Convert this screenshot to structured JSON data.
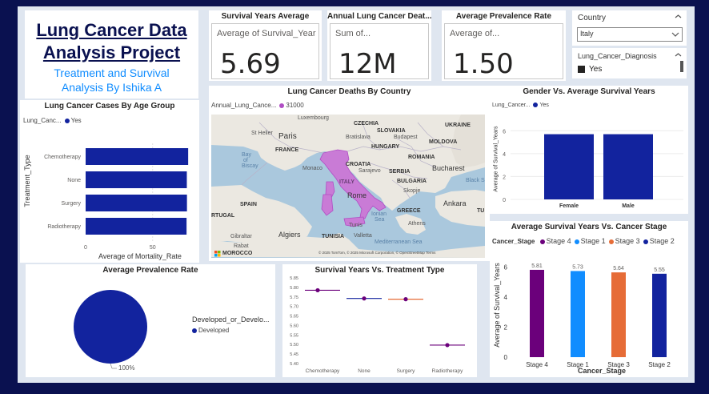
{
  "title": {
    "line1": "Lung Cancer Data",
    "line2": "Analysis Project",
    "sub1": "Treatment and Survival",
    "sub2": "Analysis By Ishika A"
  },
  "cards": [
    {
      "head": "Survival Years Average",
      "label": "Average of Survival_Years",
      "value": "5.69"
    },
    {
      "head": "Annual Lung Cancer Deat...",
      "label": "Sum of...",
      "value": "12M"
    },
    {
      "head": "Average Prevalence Rate",
      "label": "Average of...",
      "value": "1.50"
    }
  ],
  "filters": {
    "country_label": "Country",
    "country_value": "Italy",
    "diagnosis_label": "Lung_Cancer_Diagnosis",
    "diagnosis_value": "Yes"
  },
  "map": {
    "title": "Lung Cancer Deaths By Country",
    "legend_label": "Annual_Lung_Cance...",
    "legend_value": "31000",
    "attribution": "© 2025 TomTom, © 2025 Microsoft Corporation, © OpenStreetMap  Terms",
    "places": [
      "Luxembourg",
      "CZECHIA",
      "UKRAINE",
      "SLOVAKIA",
      "MOLDOVA",
      "St Helier",
      "Paris",
      "Bratislava",
      "Budapest",
      "FRANCE",
      "HUNGARY",
      "ROMANIA",
      "CROATIA",
      "Bay of Biscay",
      "Monaco",
      "Sarajevo",
      "SERBIA",
      "Bucharest",
      "ITALY",
      "BULGARIA",
      "Black Se",
      "Skopje",
      "SPAIN",
      "Rome",
      "GREECE",
      "Ankara",
      "RTUGAL",
      "Ionian Sea",
      "Athens",
      "TU",
      "Tunis",
      "Gibraltar",
      "Algiers",
      "TUNISIA",
      "Rabat",
      "MOROCCO",
      "Valletta",
      "Mediterranean Sea"
    ]
  },
  "age_chart": {
    "title": "Lung Cancer Cases By Age Group",
    "legend_label": "Lung_Canc...",
    "legend_value": "Yes",
    "xlabel": "Average of Mortality_Rate",
    "ylabel": "Treatment_Type"
  },
  "gender_chart": {
    "title": "Gender Vs. Average Survival Years",
    "legend_label": "Lung_Cancer...",
    "legend_value": "Yes",
    "ylabel": "Average of Survival_Years"
  },
  "stage_chart": {
    "title": "Average Survival Years Vs. Cancer Stage",
    "legend_label": "Cancer_Stage",
    "xlabel": "Cancer_Stage",
    "ylabel": "Average of Survival_Years"
  },
  "prevalence_chart": {
    "title": "Average Prevalence Rate",
    "legend_label": "Developed_or_Develo...",
    "legend_value": "Developed",
    "slice_label": "100%"
  },
  "treatment_chart": {
    "title": "Survival Years Vs. Treatment Type"
  },
  "chart_data": [
    {
      "type": "bar",
      "orientation": "horizontal",
      "title": "Lung Cancer Cases By Age Group",
      "categories": [
        "Chemotherapy",
        "None",
        "Surgery",
        "Radiotherapy"
      ],
      "values": [
        76.5,
        75.5,
        75.6,
        75.3
      ],
      "xlabel": "Average of Mortality_Rate",
      "ylabel": "Treatment_Type",
      "xticks": [
        "0",
        "50"
      ],
      "xlim": [
        0,
        80
      ],
      "series": [
        {
          "name": "Yes",
          "color": "#12239e"
        }
      ]
    },
    {
      "type": "bar",
      "title": "Gender Vs. Average Survival Years",
      "categories": [
        "Female",
        "Male"
      ],
      "values": [
        5.7,
        5.7
      ],
      "ylabel": "Average of Survival_Years",
      "yticks": [
        "0",
        "2",
        "4",
        "6"
      ],
      "ylim": [
        0,
        7
      ],
      "series": [
        {
          "name": "Yes",
          "color": "#12239e"
        }
      ]
    },
    {
      "type": "bar",
      "title": "Average Survival Years Vs. Cancer Stage",
      "categories": [
        "Stage 4",
        "Stage 1",
        "Stage 3",
        "Stage 2"
      ],
      "values": [
        5.81,
        5.73,
        5.64,
        5.55
      ],
      "labels": [
        "5.81",
        "5.73",
        "5.64",
        "5.55"
      ],
      "colors": [
        "#6b007b",
        "#118dff",
        "#e66c37",
        "#12239e"
      ],
      "xlabel": "Cancer_Stage",
      "ylabel": "Average of Survival_Years",
      "yticks": [
        "0",
        "2",
        "4",
        "6"
      ],
      "ylim": [
        0,
        6.5
      ],
      "legend": [
        "Stage 4",
        "Stage 1",
        "Stage 3",
        "Stage 2"
      ]
    },
    {
      "type": "pie",
      "title": "Average Prevalence Rate",
      "slices": [
        {
          "name": "Developed",
          "value": 100,
          "color": "#12239e"
        }
      ],
      "slice_label": "100%"
    },
    {
      "type": "scatter",
      "title": "Survival Years Vs. Treatment Type",
      "categories": [
        "Chemotherapy",
        "None",
        "Surgery",
        "Radiotherapy"
      ],
      "values": [
        5.785,
        5.742,
        5.738,
        5.497
      ],
      "line_colors": [
        "#6b007b",
        "#12239e",
        "#e66c37",
        "#6b007b"
      ],
      "yticks": [
        "5.40",
        "5.45",
        "5.50",
        "5.55",
        "5.60",
        "5.65",
        "5.70",
        "5.75",
        "5.80",
        "5.85"
      ],
      "ylim": [
        5.4,
        5.85
      ]
    }
  ]
}
